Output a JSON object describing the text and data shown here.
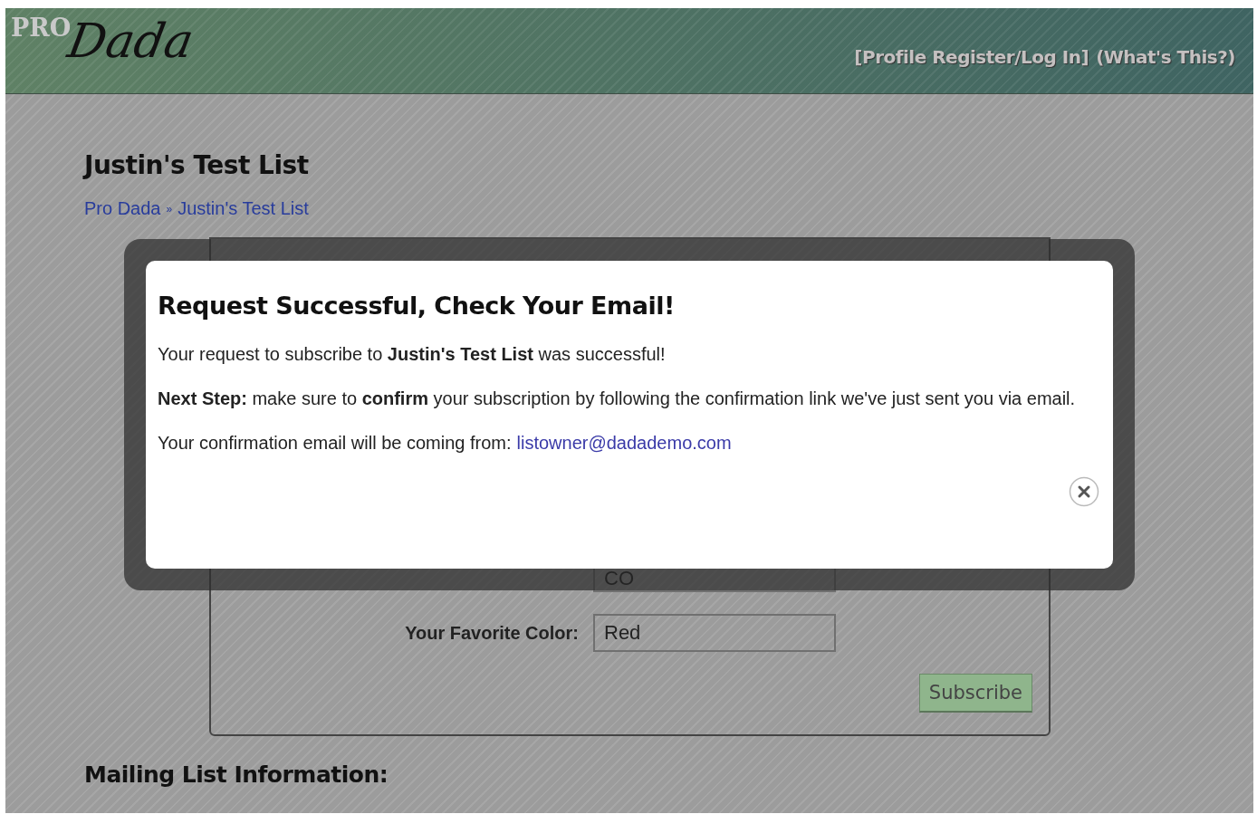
{
  "header": {
    "logo": {
      "prefix": "PRO",
      "name": "Dada"
    },
    "links": [
      "[Profile Register/Log In]",
      "(What's This?)"
    ]
  },
  "page_title": "Justin's Test List",
  "breadcrumb": {
    "items": [
      "Pro Dada",
      "Justin's Test List"
    ],
    "separator": "»"
  },
  "form": {
    "fields": [
      {
        "value": "CO"
      },
      {
        "label": "Your Favorite Color:",
        "value": "Red"
      }
    ],
    "button": "Subscribe"
  },
  "section_heading": "Mailing List Information:",
  "dialog": {
    "title": "Request Successful, Check Your Email!",
    "paragraphs": [
      "Your request to subscribe to **Justin's Test List** was successful!",
      "**Next Step:** make sure to **confirm** your subscription by following the confirmation link we've just sent you via email."
    ],
    "email_label": "Your confirmation email will be coming from:",
    "email": "listowner@dadademo.com"
  }
}
